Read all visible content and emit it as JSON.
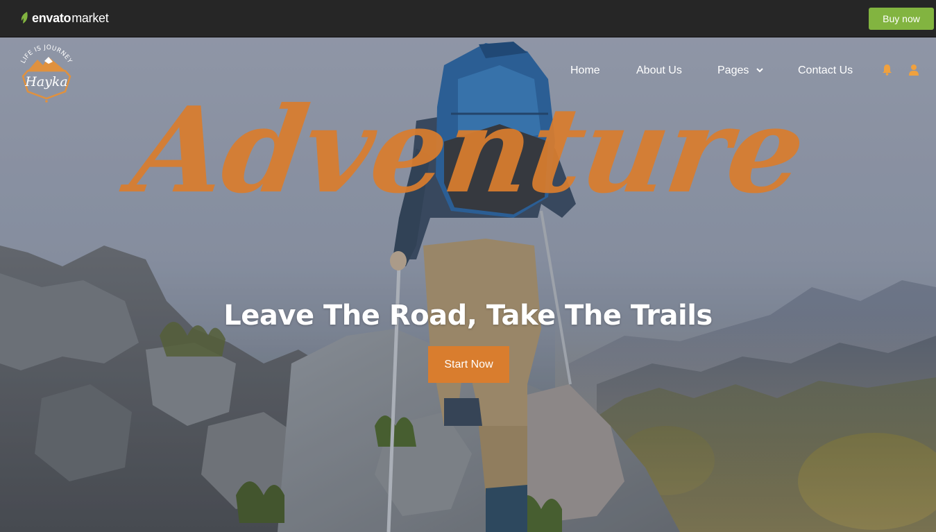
{
  "envato_bar": {
    "brand_strong": "envato",
    "brand_light": "market",
    "buy_label": "Buy now",
    "colors": {
      "bar": "#262626",
      "buy": "#82b440",
      "leaf": "#82b440"
    }
  },
  "site": {
    "logo": {
      "arc_text": "LIFE IS JOURNEY",
      "name": "Hayka"
    },
    "nav": {
      "items": [
        "Home",
        "About Us",
        "Pages",
        "Contact Us"
      ],
      "icons": [
        "bell-icon",
        "user-icon"
      ]
    },
    "accent_color": "#d97d2e"
  },
  "hero": {
    "script_word": "Adventure",
    "headline": "Leave The Road, Take The Trails",
    "cta_label": "Start Now"
  }
}
